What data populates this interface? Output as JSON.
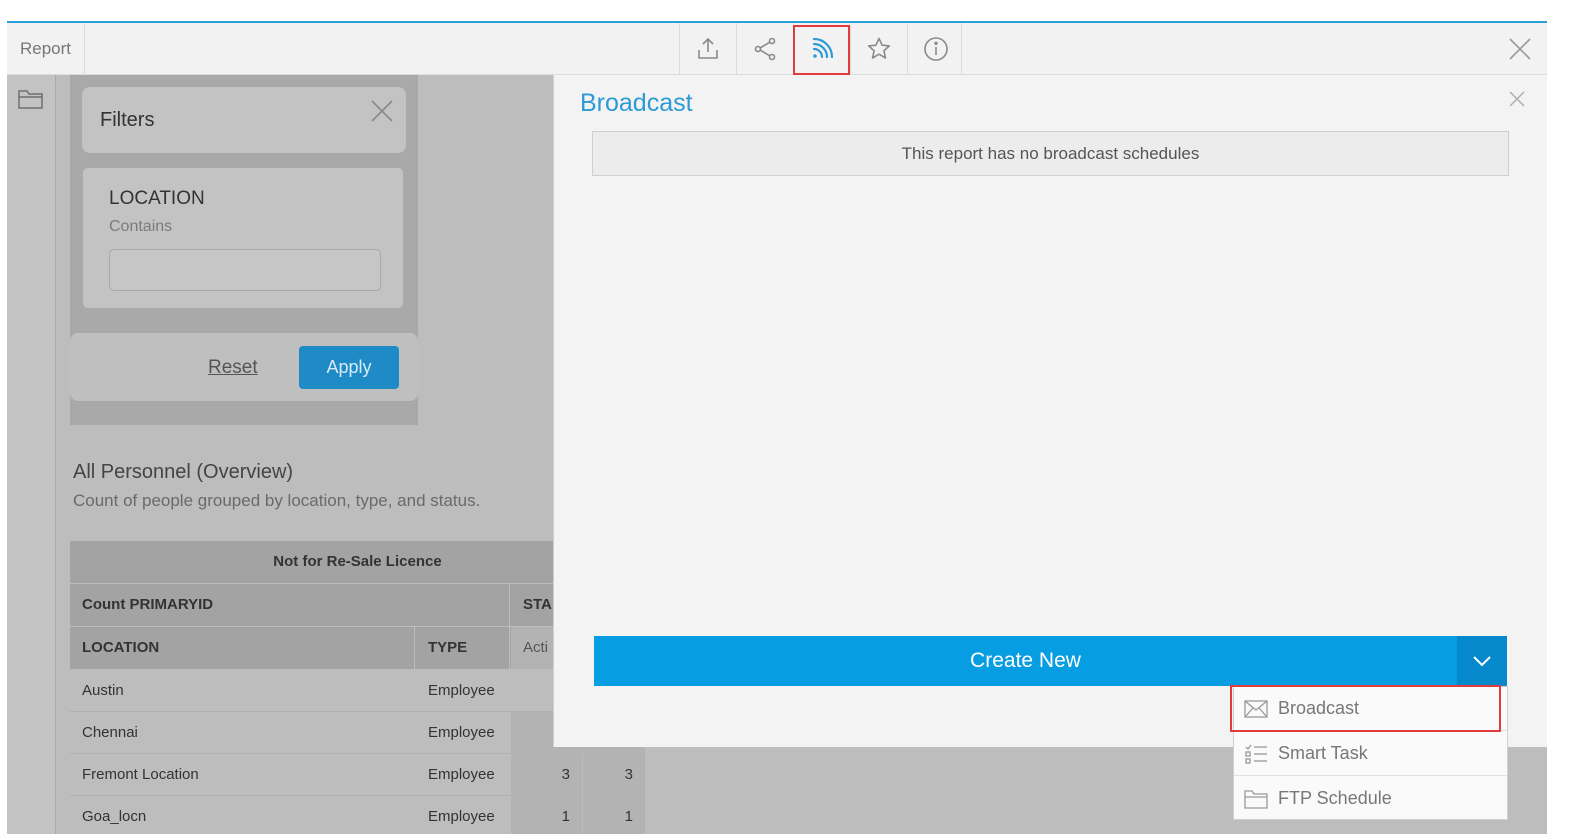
{
  "toolbar": {
    "title": "Report",
    "buttons": [
      {
        "name": "upload-export-icon"
      },
      {
        "name": "share-icon"
      },
      {
        "name": "broadcast-rss-icon",
        "active": true
      },
      {
        "name": "star-favorite-icon"
      },
      {
        "name": "info-icon"
      }
    ],
    "close_icon": "close-icon",
    "accent": "#2a9fd8",
    "highlight_color": "#e03c3c"
  },
  "sidebar": {
    "icon": "folder-icon"
  },
  "filters": {
    "title": "Filters",
    "field_name": "LOCATION",
    "operator": "Contains",
    "value": "",
    "reset_label": "Reset",
    "apply_label": "Apply"
  },
  "report": {
    "title": "All Personnel (Overview)",
    "subtitle": "Count of people grouped by location, type, and status.",
    "table": {
      "banner": "Not for Re-Sale Licence",
      "measure_header": "Count PRIMARYID",
      "status_header": "STA",
      "location_header": "LOCATION",
      "type_header": "TYPE",
      "active_header": "Acti",
      "rows": [
        {
          "location": "Austin",
          "type": "Employee",
          "v1": "",
          "v2": ""
        },
        {
          "location": "Chennai",
          "type": "Employee",
          "v1": "",
          "v2": ""
        },
        {
          "location": "Fremont Location",
          "type": "Employee",
          "v1": "3",
          "v2": "3"
        },
        {
          "location": "Goa_locn",
          "type": "Employee",
          "v1": "1",
          "v2": "1"
        }
      ]
    }
  },
  "broadcast_panel": {
    "title": "Broadcast",
    "empty_message": "This report has no broadcast schedules",
    "create_label": "Create New",
    "create_color": "#069de3",
    "dropdown": [
      {
        "label": "Broadcast",
        "icon": "envelope-icon",
        "highlighted": true
      },
      {
        "label": "Smart Task",
        "icon": "task-list-icon"
      },
      {
        "label": "FTP Schedule",
        "icon": "folder-icon"
      }
    ]
  }
}
